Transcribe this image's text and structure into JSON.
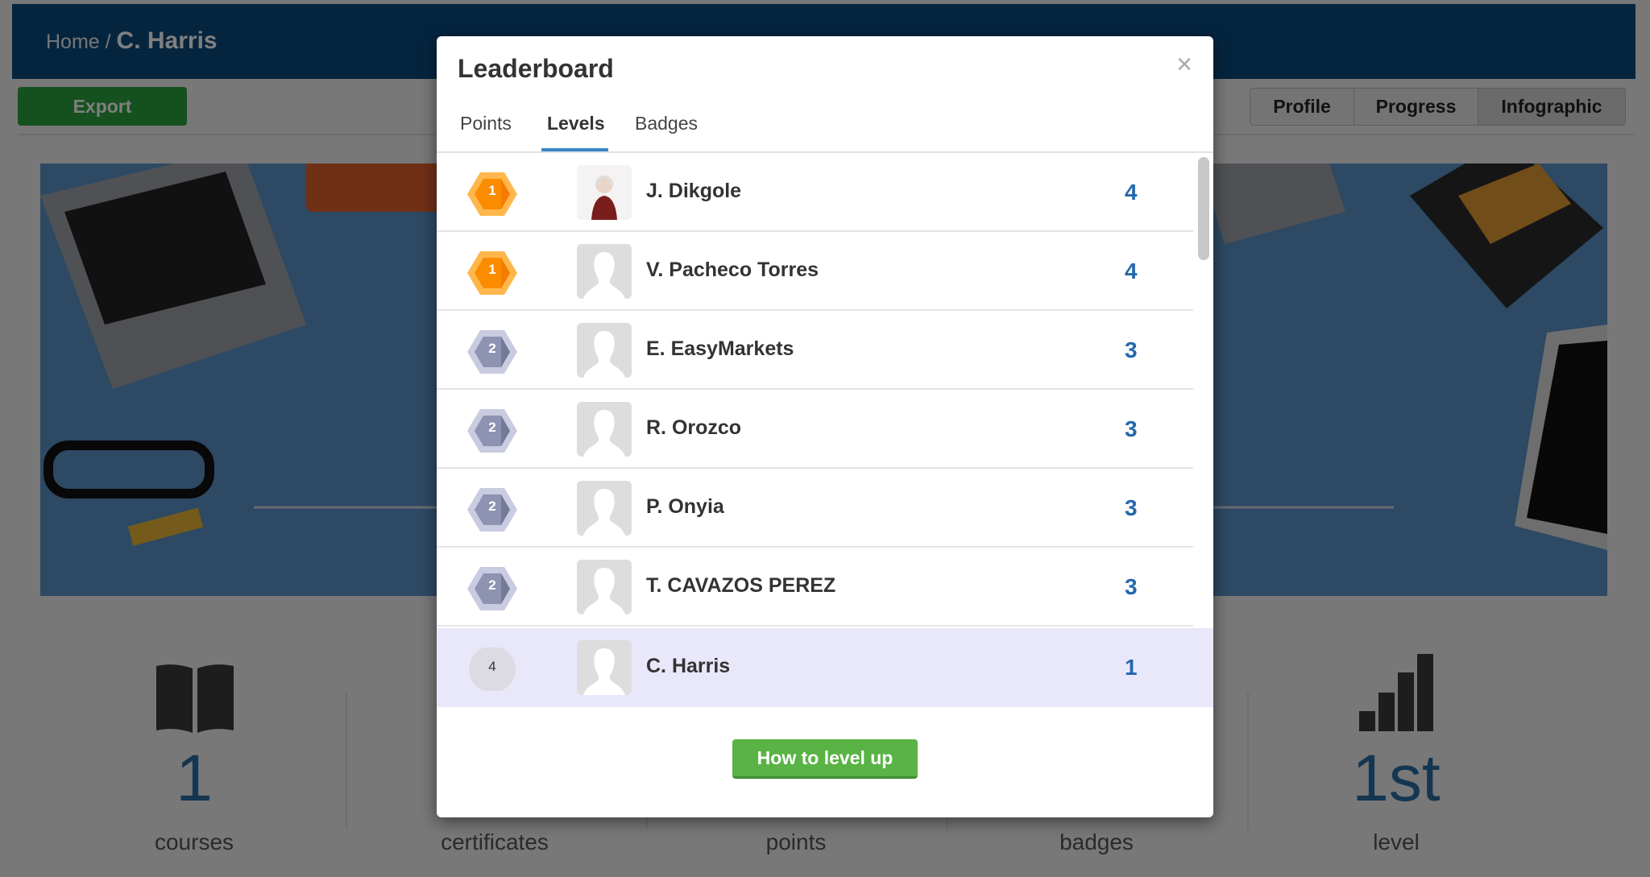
{
  "breadcrumb": {
    "home": "Home",
    "separator": "/",
    "current": "C. Harris"
  },
  "toolbar": {
    "export_label": "Export",
    "views": [
      "Profile",
      "Progress",
      "Infographic"
    ]
  },
  "stats": [
    {
      "value": "1",
      "label": "courses",
      "icon": "book-icon"
    },
    {
      "value": "",
      "label": "certificates",
      "icon": "certificate-icon"
    },
    {
      "value": "",
      "label": "points",
      "icon": "star-icon"
    },
    {
      "value": "",
      "label": "badges",
      "icon": "badge-icon"
    },
    {
      "value": "1st",
      "label": "level",
      "icon": "bar-chart-icon"
    }
  ],
  "modal": {
    "title": "Leaderboard",
    "close": "×",
    "tabs": [
      "Points",
      "Levels",
      "Badges"
    ],
    "active_tab": "Levels",
    "rows": [
      {
        "rank": "1",
        "name": "J. Dikgole",
        "value": "4",
        "medal": "gold",
        "photo": true
      },
      {
        "rank": "1",
        "name": "V. Pacheco Torres",
        "value": "4",
        "medal": "gold"
      },
      {
        "rank": "2",
        "name": "E. EasyMarkets",
        "value": "3",
        "medal": "silver"
      },
      {
        "rank": "2",
        "name": "R. Orozco",
        "value": "3",
        "medal": "silver"
      },
      {
        "rank": "2",
        "name": "P. Onyia",
        "value": "3",
        "medal": "silver"
      },
      {
        "rank": "2",
        "name": "T. CAVAZOS PEREZ",
        "value": "3",
        "medal": "silver"
      }
    ],
    "current_user": {
      "rank": "4",
      "name": "C. Harris",
      "value": "1"
    },
    "level_up_label": "How to level up"
  },
  "colors": {
    "header": "#0b4b7e",
    "accent": "#2468ad",
    "gold": "#fb8c00",
    "silver": "#8d93b0",
    "button_green": "#5ab345",
    "highlight": "#e9e8fb"
  }
}
